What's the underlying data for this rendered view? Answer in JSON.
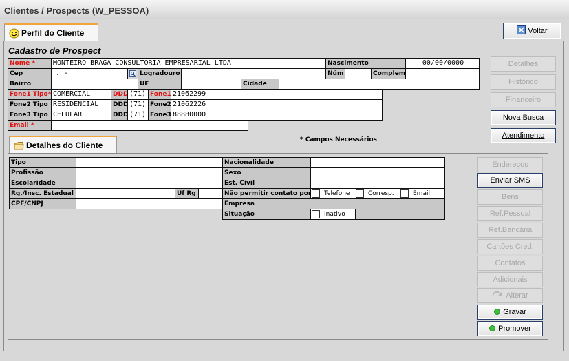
{
  "window": {
    "title": "Clientes / Prospects (W_PESSOA)"
  },
  "tabs": {
    "profile": "Perfil do Cliente",
    "details": "Detalhes do Cliente"
  },
  "header": {
    "voltar": "Voltar",
    "heading": "Cadastro de Prospect"
  },
  "form": {
    "nome_label": "Nome *",
    "nome": "MONTEIRO BRAGA CONSULTORIA EMPRESARIAL LTDA",
    "nascimento_label": "Nascimento",
    "nascimento": "00/00/0000",
    "cep_label": "Cep",
    "cep": ".  -",
    "logradouro_label": "Logradouro",
    "num_label": "Núm",
    "complem_label": "Complem.",
    "bairro_label": "Bairro",
    "uf_label": "UF",
    "cidade_label": "Cidade",
    "phones": [
      {
        "tipo_label": "Fone1 Tipo*",
        "tipo": "COMERCIAL",
        "ddd_label": "DDD",
        "ddd": "(71)",
        "fone_label": "Fone1",
        "fone": "21062299"
      },
      {
        "tipo_label": "Fone2 Tipo",
        "tipo": "RESIDENCIAL",
        "ddd_label": "DDD",
        "ddd": "(71)",
        "fone_label": "Fone2",
        "fone": "21062226"
      },
      {
        "tipo_label": "Fone3 Tipo",
        "tipo": "CELULAR",
        "ddd_label": "DDD",
        "ddd": "(71)",
        "fone_label": "Fone3",
        "fone": "88880000"
      }
    ],
    "email_label": "Email *",
    "required_note": "* Campos Necessários"
  },
  "side_buttons": {
    "detalhes": "Detalhes",
    "historico": "Histórico",
    "financeiro": "Financeiro",
    "nova_busca": "Nova Busca",
    "atendimento": "Atendimento"
  },
  "details": {
    "tipo": "Tipo",
    "profissao": "Profissão",
    "escolaridade": "Escolaridade",
    "rg": "Rg./Insc. Estadual",
    "uf_rg": "Uf Rg",
    "cpf": "CPF/CNPJ",
    "nacionalidade": "Nacionalidade",
    "sexo": "Sexo",
    "est_civil": "Est. Civil",
    "nao_permitir": "Não permitir contato por",
    "telefone": "Telefone",
    "corresp": "Corresp.",
    "email": "Email",
    "empresa": "Empresa",
    "situacao": "Situação",
    "inativo": "Inativo"
  },
  "detail_buttons": {
    "enderecos": "Endereços",
    "enviar_sms": "Enviar SMS",
    "bens": "Bens",
    "ref_pessoal": "Ref.Pessoal",
    "ref_bancaria": "Ref.Bancária",
    "cartoes": "Cartões Cred.",
    "contatos": "Contatos",
    "adicionais": "Adicionais",
    "alterar": "Alterar",
    "gravar": "Gravar",
    "promover": "Promover"
  },
  "colors": {
    "required": "#e01010",
    "tab_accent": "#f2a33a",
    "ok_green": "#3fbf3f"
  }
}
